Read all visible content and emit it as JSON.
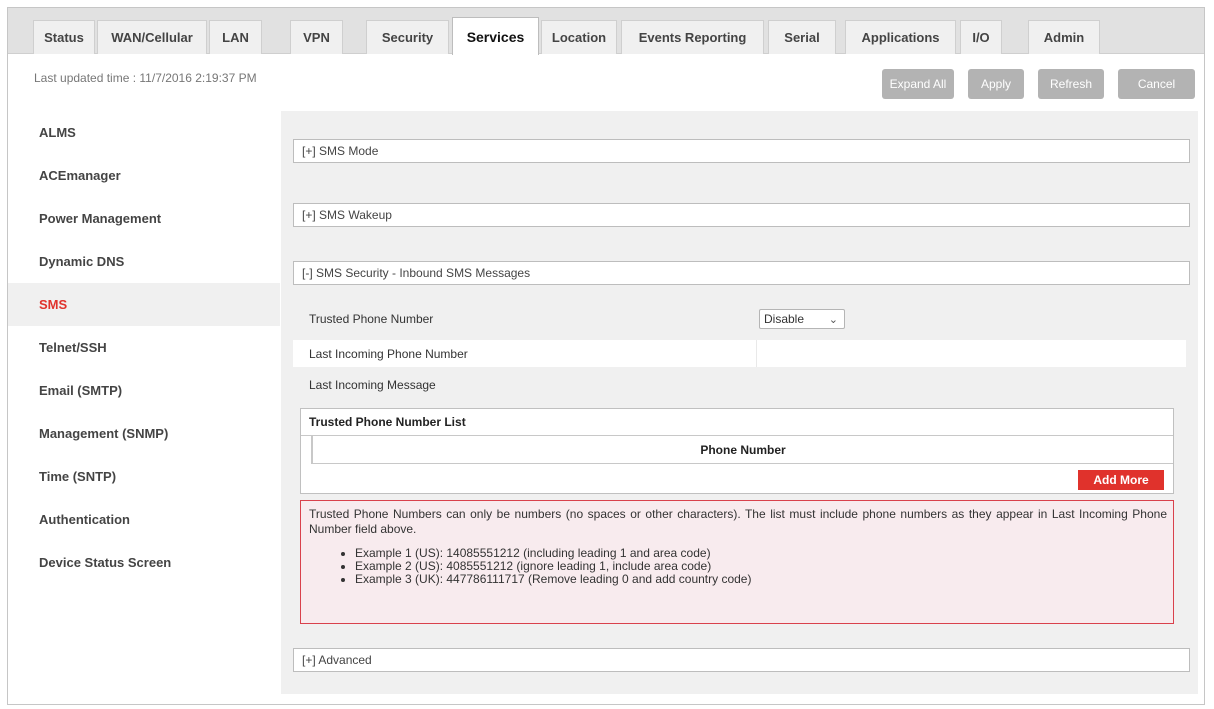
{
  "tabs": [
    {
      "label": "Status"
    },
    {
      "label": "WAN/Cellular"
    },
    {
      "label": "LAN"
    },
    {
      "label": "VPN"
    },
    {
      "label": "Security"
    },
    {
      "label": "Services"
    },
    {
      "label": "Location"
    },
    {
      "label": "Events Reporting"
    },
    {
      "label": "Serial"
    },
    {
      "label": "Applications"
    },
    {
      "label": "I/O"
    },
    {
      "label": "Admin"
    }
  ],
  "active_tab": "Services",
  "last_updated": "Last updated time : 11/7/2016 2:19:37 PM",
  "toolbar": {
    "expand_all": "Expand All",
    "apply": "Apply",
    "refresh": "Refresh",
    "cancel": "Cancel"
  },
  "sidebar": {
    "items": [
      {
        "label": "ALMS"
      },
      {
        "label": "ACEmanager"
      },
      {
        "label": "Power Management"
      },
      {
        "label": "Dynamic DNS"
      },
      {
        "label": "SMS"
      },
      {
        "label": "Telnet/SSH"
      },
      {
        "label": "Email (SMTP)"
      },
      {
        "label": "Management (SNMP)"
      },
      {
        "label": "Time (SNTP)"
      },
      {
        "label": "Authentication"
      },
      {
        "label": "Device Status Screen"
      }
    ],
    "active": "SMS"
  },
  "sections": {
    "sms_mode": "[+] SMS Mode",
    "sms_wakeup": "[+] SMS Wakeup",
    "sms_security": "[-] SMS Security - Inbound SMS Messages",
    "advanced": "[+] Advanced"
  },
  "fields": {
    "trusted_phone_number": {
      "label": "Trusted Phone Number",
      "value": "Disable"
    },
    "last_incoming_phone": {
      "label": "Last Incoming Phone Number",
      "value": ""
    },
    "last_incoming_message": {
      "label": "Last Incoming Message",
      "value": ""
    }
  },
  "trusted_list": {
    "title": "Trusted Phone Number List",
    "column": "Phone Number",
    "add_more": "Add More"
  },
  "note": {
    "text": "Trusted Phone Numbers can only be numbers (no spaces or other characters). The list must include phone numbers as they appear in Last Incoming Phone Number field above.",
    "examples": [
      "Example 1 (US): 14085551212 (including leading 1 and area code)",
      "Example 2 (US): 4085551212 (ignore leading 1, include area code)",
      "Example 3 (UK): 447786111717 (Remove leading 0 and add country code)"
    ]
  },
  "colors": {
    "accent_red": "#e0322c",
    "note_bg": "#f8ebee",
    "panel_bg": "#f0f0f0",
    "button_gray": "#b3b3b3"
  }
}
